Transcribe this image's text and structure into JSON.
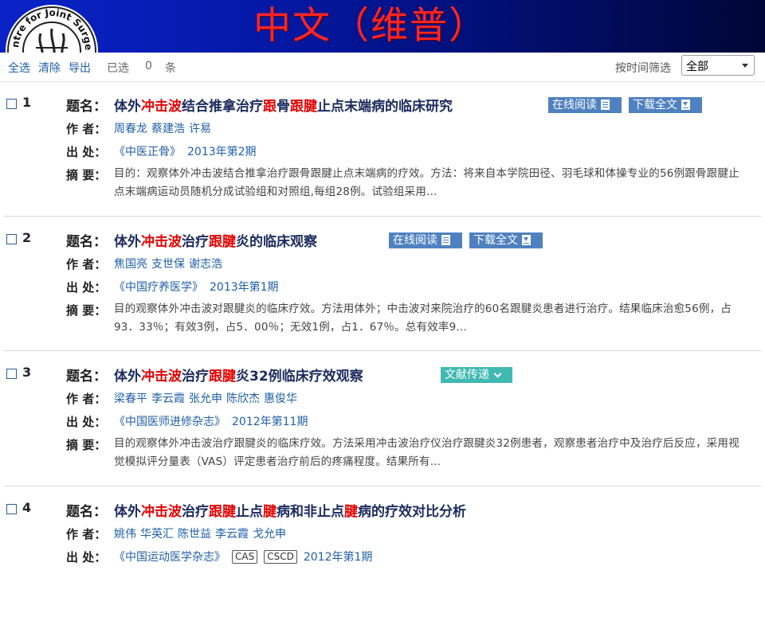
{
  "header": {
    "title": "中文（维普）",
    "title_color": "#ff2525",
    "logo_icon": "centre-for-joint-surgery-logo",
    "logo_text": "Centre for Joint Surgery"
  },
  "toolbar": {
    "select_all": "全选",
    "clear": "清除",
    "export": "导出",
    "selected_label": "已选",
    "selected_count": "0",
    "unit": "条",
    "filter_label": "按时间筛选",
    "filter_value": "全部"
  },
  "labels": {
    "title": "题名：",
    "author": "作 者：",
    "source": "出 处：",
    "abstract": "摘 要："
  },
  "results": [
    {
      "index": "1",
      "title": [
        {
          "t": "体外"
        },
        {
          "t": "冲击波",
          "hl": true
        },
        {
          "t": "结合推拿治疗"
        },
        {
          "t": "跟",
          "hl": true
        },
        {
          "t": "骨"
        },
        {
          "t": "跟腱",
          "hl": true
        },
        {
          "t": "止点末端病的临床研究"
        }
      ],
      "authors": [
        "周春龙",
        "蔡建浩",
        "许易"
      ],
      "journal": "《中医正骨》",
      "issue": "2013年第2期",
      "tags": [],
      "abstract": "目的：观察体外冲击波结合推拿治疗跟骨跟腱止点末端病的疗效。方法：将来自本学院田径、羽毛球和体操专业的56例跟骨跟腱止点末端病运动员随机分成试验组和对照组,每组28例。试验组采用…",
      "buttons": [
        {
          "label": "在线阅读",
          "icon": "document-icon",
          "style": "blue"
        },
        {
          "label": "下载全文",
          "icon": "download-icon",
          "style": "blue"
        }
      ]
    },
    {
      "index": "2",
      "title": [
        {
          "t": "体外"
        },
        {
          "t": "冲击波",
          "hl": true
        },
        {
          "t": "治疗"
        },
        {
          "t": "跟腱",
          "hl": true
        },
        {
          "t": "炎的临床观察"
        }
      ],
      "authors": [
        "焦国亮",
        "支世保",
        "谢志浩"
      ],
      "journal": "《中国疗养医学》",
      "issue": "2013年第1期",
      "tags": [],
      "abstract": "目的观察体外冲击波对跟腱炎的临床疗效。方法用体外；中击波对来院治疗的60名跟腱炎患者进行治疗。结果临床治愈56例，占93．33％；有效3例，占5．00％；无效1例，占1．67％。总有效率9…",
      "buttons": [
        {
          "label": "在线阅读",
          "icon": "document-icon",
          "style": "blue"
        },
        {
          "label": "下载全文",
          "icon": "download-icon",
          "style": "blue"
        }
      ]
    },
    {
      "index": "3",
      "title": [
        {
          "t": "体外"
        },
        {
          "t": "冲击波",
          "hl": true
        },
        {
          "t": "治疗"
        },
        {
          "t": "跟腱",
          "hl": true
        },
        {
          "t": "炎32例临床疗效观察"
        }
      ],
      "authors": [
        "梁春平",
        "李云霞",
        "张允申",
        "陈欣杰",
        "惠俊华"
      ],
      "journal": "《中国医师进修杂志》",
      "issue": "2012年第11期",
      "tags": [],
      "abstract": "目的观察体外冲击波治疗跟腱炎的临床疗效。方法采用冲击波治疗仪治疗跟腱炎32例患者，观察患者治疗中及治疗后反应，采用视觉模拟评分量表（VAS）评定患者治疗前后的疼痛程度。结果所有…",
      "buttons": [
        {
          "label": "文献传递",
          "icon": "send-icon",
          "style": "teal"
        }
      ]
    },
    {
      "index": "4",
      "title": [
        {
          "t": "体外"
        },
        {
          "t": "冲击波",
          "hl": true
        },
        {
          "t": "治疗"
        },
        {
          "t": "跟腱",
          "hl": true
        },
        {
          "t": "止点"
        },
        {
          "t": "腱",
          "hl": true
        },
        {
          "t": "病和非止点"
        },
        {
          "t": "腱",
          "hl": true
        },
        {
          "t": "病的疗效对比分析"
        }
      ],
      "authors": [
        "姚伟",
        "华英汇",
        "陈世益",
        "李云霞",
        "戈允申"
      ],
      "journal": "《中国运动医学杂志》",
      "issue": "2012年第1期",
      "tags": [
        "CAS",
        "CSCD"
      ],
      "abstract": "",
      "buttons": []
    }
  ]
}
